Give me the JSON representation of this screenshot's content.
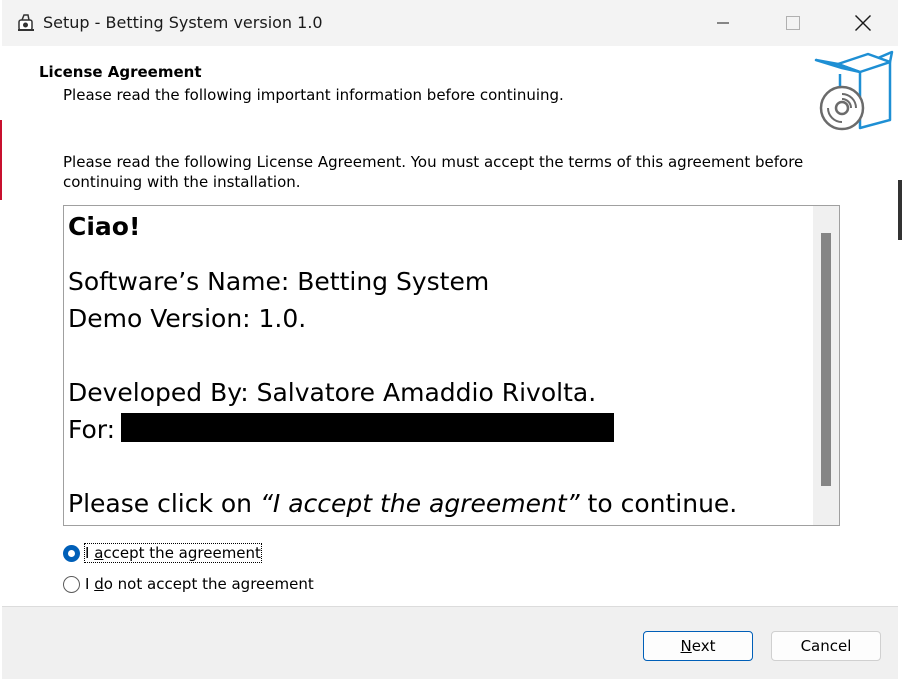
{
  "window": {
    "title": "Setup - Betting System version 1.0",
    "minimize_icon": "minimize-icon",
    "maximize_icon": "maximize-icon",
    "close_icon": "close-icon"
  },
  "header": {
    "title": "License Agreement",
    "subtitle": "Please read the following important information before continuing.",
    "icon": "install-box-icon"
  },
  "intro": "Please read the following License Agreement. You must accept the terms of this agreement before continuing with the installation.",
  "license": {
    "greeting": "Ciao!",
    "software_name": "Software’s Name: Betting System",
    "demo_version": "Demo Version: 1.0.",
    "developed_by": "Developed By: Salvatore Amaddio Rivolta.",
    "for_label": "For:",
    "click_prefix": "Please click on ",
    "click_quote": "“I accept the agreement”",
    "click_suffix": " to continue."
  },
  "options": {
    "accept_pre": "I ",
    "accept_ul": "a",
    "accept_post": "ccept the agreement",
    "decline_pre": "I ",
    "decline_ul": "d",
    "decline_post": "o not accept the agreement",
    "selected": "accept"
  },
  "footer": {
    "next_ul": "N",
    "next_rest": "ext",
    "cancel": "Cancel"
  },
  "colors": {
    "accent": "#005fb8",
    "titlebar": "#f3f3f3",
    "footer": "#f0f0f0"
  }
}
